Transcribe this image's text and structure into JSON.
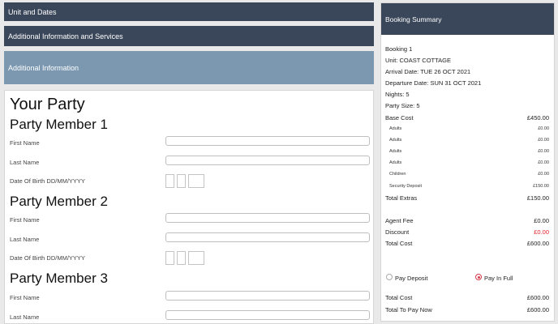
{
  "sections": {
    "unit_and_dates": "Unit and Dates",
    "additional_info_services": "Additional Information and Services",
    "additional_information": "Additional Information"
  },
  "party": {
    "title": "Your Party",
    "members": [
      {
        "heading": "Party Member 1",
        "first_name_label": "First Name",
        "last_name_label": "Last Name",
        "dob_label": "Date Of Birth DD/MM/YYYY",
        "first_name": "",
        "last_name": "",
        "dob_day": "",
        "dob_month": "",
        "dob_year": ""
      },
      {
        "heading": "Party Member 2",
        "first_name_label": "First Name",
        "last_name_label": "Last Name",
        "dob_label": "Date Of Birth DD/MM/YYYY",
        "first_name": "",
        "last_name": "",
        "dob_day": "",
        "dob_month": "",
        "dob_year": ""
      },
      {
        "heading": "Party Member 3",
        "first_name_label": "First Name",
        "last_name_label": "Last Name",
        "first_name": "",
        "last_name": ""
      }
    ]
  },
  "summary": {
    "title": "Booking Summary",
    "booking": "Booking 1",
    "unit": "Unit: COAST COTTAGE",
    "arrival": "Arrival Date: TUE 26 OCT 2021",
    "departure": "Departure Date: SUN 31 OCT 2021",
    "nights": "Nights: 5",
    "party_size": "Party Size: 5",
    "base_cost_label": "Base Cost",
    "base_cost": "£450.00",
    "extras": [
      {
        "label": "Adults",
        "value": "£0.00"
      },
      {
        "label": "Adults",
        "value": "£0.00"
      },
      {
        "label": "Adults",
        "value": "£0.00"
      },
      {
        "label": "Adults",
        "value": "£0.00"
      },
      {
        "label": "Children",
        "value": "£0.00"
      },
      {
        "label": "Security Deposit",
        "value": "£150.00"
      }
    ],
    "total_extras_label": "Total Extras",
    "total_extras": "£150.00",
    "agent_fee_label": "Agent Fee",
    "agent_fee": "£0.00",
    "discount_label": "Discount",
    "discount": "£0.00",
    "total_cost_label": "Total Cost",
    "total_cost": "£600.00",
    "pay_deposit_label": "Pay Deposit",
    "pay_in_full_label": "Pay In Full",
    "pay_selected": "Pay In Full",
    "total_cost2_label": "Total Cost",
    "total_cost2": "£600.00",
    "total_to_pay_label": "Total To Pay Now",
    "total_to_pay": "£600.00"
  },
  "colors": {
    "header_dark": "#3a475a",
    "header_light": "#7b98b0",
    "accent": "#d63b4b",
    "discount_red": "#e0242a"
  }
}
